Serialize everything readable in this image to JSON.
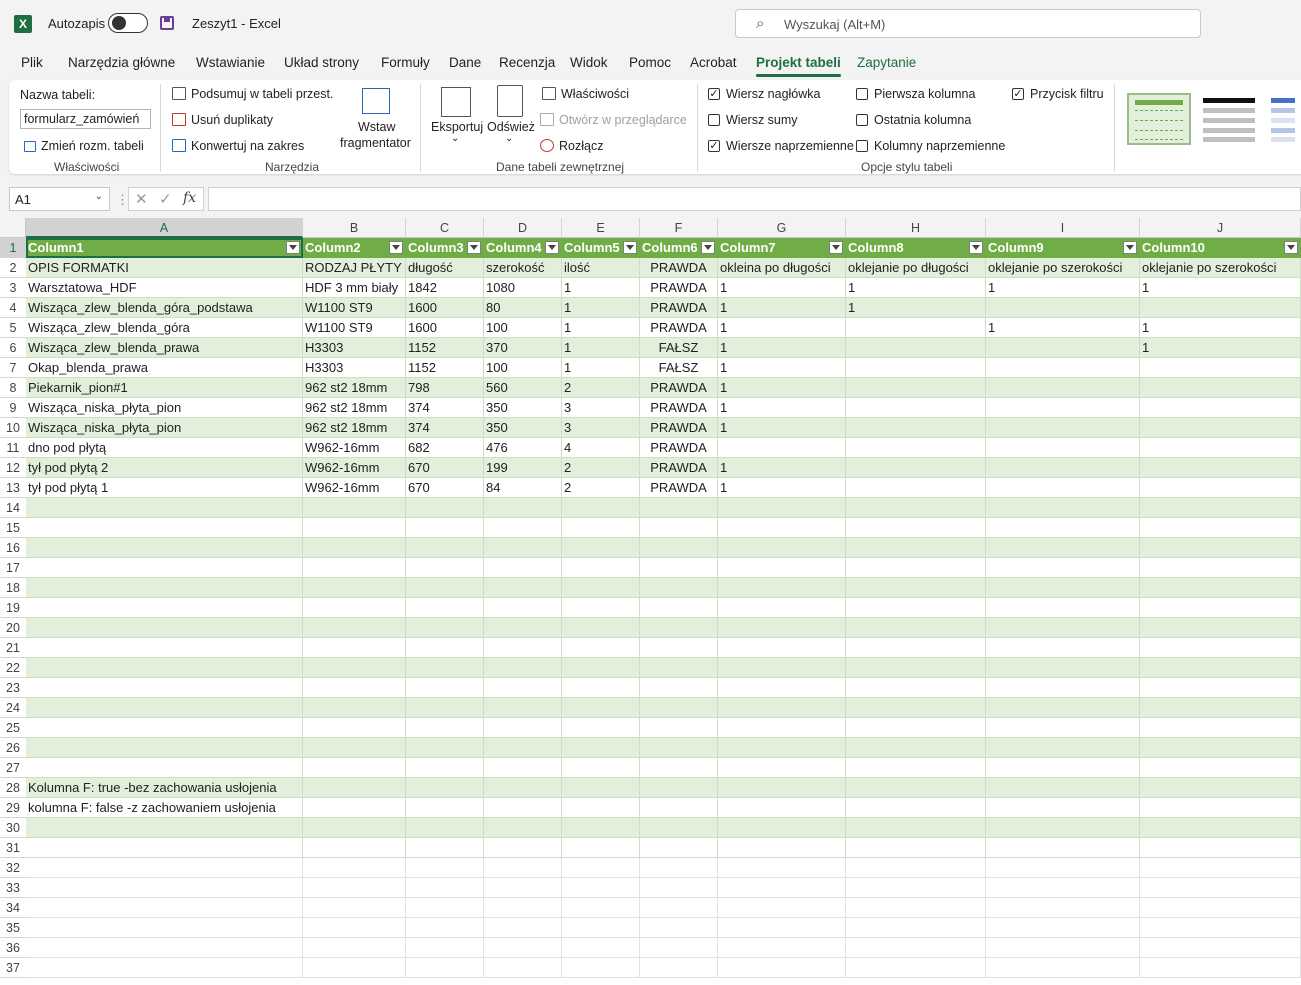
{
  "app": {
    "logo_letter": "X",
    "autosave_label": "Autozapis",
    "document_title": "Zeszyt1  -  Excel",
    "search_placeholder": "Wyszukaj (Alt+M)"
  },
  "tabs": [
    "Plik",
    "Narzędzia główne",
    "Wstawianie",
    "Układ strony",
    "Formuły",
    "Dane",
    "Recenzja",
    "Widok",
    "Pomoc",
    "Acrobat",
    "Projekt tabeli",
    "Zapytanie"
  ],
  "active_tab": "Projekt tabeli",
  "ribbon": {
    "table_name_label": "Nazwa tabeli:",
    "table_name_value": "formularz_zamówień",
    "resize_table": "Zmień rozm. tabeli",
    "group_properties": "Właściwości",
    "summarize_pivot": "Podsumuj w tabeli przest.",
    "remove_duplicates": "Usuń duplikaty",
    "convert_to_range": "Konwertuj na zakres",
    "insert_slicer_line1": "Wstaw",
    "insert_slicer_line2": "fragmentator",
    "group_tools": "Narzędzia",
    "export": "Eksportuj",
    "refresh": "Odśwież",
    "properties": "Właściwości",
    "open_in_browser": "Otwórz w przeglądarce",
    "unlink": "Rozłącz",
    "group_external": "Dane tabeli zewnętrznej",
    "options": [
      {
        "label": "Wiersz nagłówka",
        "checked": true
      },
      {
        "label": "Wiersz sumy",
        "checked": false
      },
      {
        "label": "Wiersze naprzemienne",
        "checked": true
      },
      {
        "label": "Pierwsza kolumna",
        "checked": false
      },
      {
        "label": "Ostatnia kolumna",
        "checked": false
      },
      {
        "label": "Kolumny naprzemienne",
        "checked": false
      },
      {
        "label": "Przycisk filtru",
        "checked": true
      }
    ],
    "group_style_options": "Opcje stylu tabeli"
  },
  "formula_bar": {
    "name_box": "A1",
    "fx": "fx",
    "formula": ""
  },
  "sheet": {
    "columns": [
      "A",
      "B",
      "C",
      "D",
      "E",
      "F",
      "G",
      "H",
      "I",
      "J"
    ],
    "selected_cell": "A1",
    "row_numbers": [
      "1",
      "2",
      "3",
      "4",
      "5",
      "6",
      "7",
      "8",
      "9",
      "10",
      "11",
      "12",
      "13",
      "14",
      "15",
      "16",
      "17",
      "18",
      "19",
      "20",
      "21",
      "22",
      "23",
      "24",
      "25",
      "26",
      "27",
      "28",
      "29",
      "30",
      "31",
      "32",
      "33",
      "34",
      "35",
      "36",
      "37"
    ],
    "header_row": [
      "Column1",
      "Column2",
      "Column3",
      "Column4",
      "Column5",
      "Column6",
      "Column7",
      "Column8",
      "Column9",
      "Column10"
    ],
    "rows": [
      [
        "OPIS FORMATKI",
        "RODZAJ PŁYTY",
        "długość",
        "szerokość",
        "ilość",
        "PRAWDA",
        "okleina po długości",
        "oklejanie po długości",
        "oklejanie po szerokości",
        "oklejanie po szerokości"
      ],
      [
        "Warsztatowa_HDF",
        "HDF 3 mm biały",
        "1842",
        "1080",
        "1",
        "PRAWDA",
        "1",
        "1",
        "1",
        "1"
      ],
      [
        "Wisząca_zlew_blenda_góra_podstawa",
        "W1100 ST9",
        "1600",
        "80",
        "1",
        "PRAWDA",
        "1",
        "1",
        "",
        ""
      ],
      [
        "Wisząca_zlew_blenda_góra",
        "W1100 ST9",
        "1600",
        "100",
        "1",
        "PRAWDA",
        "1",
        "",
        "1",
        "1"
      ],
      [
        "Wisząca_zlew_blenda_prawa",
        "H3303",
        "1152",
        "370",
        "1",
        "FAŁSZ",
        "1",
        "",
        "",
        "1"
      ],
      [
        "Okap_blenda_prawa",
        "H3303",
        "1152",
        "100",
        "1",
        "FAŁSZ",
        "1",
        "",
        "",
        ""
      ],
      [
        "Piekarnik_pion#1",
        "962 st2 18mm",
        "798",
        "560",
        "2",
        "PRAWDA",
        "1",
        "",
        "",
        ""
      ],
      [
        "Wisząca_niska_płyta_pion",
        "962 st2 18mm",
        "374",
        "350",
        "3",
        "PRAWDA",
        "1",
        "",
        "",
        ""
      ],
      [
        "Wisząca_niska_płyta_pion",
        "962 st2 18mm",
        "374",
        "350",
        "3",
        "PRAWDA",
        "1",
        "",
        "",
        ""
      ],
      [
        "dno pod płytą",
        "W962-16mm",
        "682",
        "476",
        "4",
        "PRAWDA",
        "",
        "",
        "",
        ""
      ],
      [
        "tył pod płytą 2",
        "W962-16mm",
        "670",
        "199",
        "2",
        "PRAWDA",
        "1",
        "",
        "",
        ""
      ],
      [
        "tył pod płytą 1",
        "W962-16mm",
        "670",
        "84",
        "2",
        "PRAWDA",
        "1",
        "",
        "",
        ""
      ],
      [
        "",
        "",
        "",
        "",
        "",
        "",
        "",
        "",
        "",
        ""
      ],
      [
        "",
        "",
        "",
        "",
        "",
        "",
        "",
        "",
        "",
        ""
      ],
      [
        "",
        "",
        "",
        "",
        "",
        "",
        "",
        "",
        "",
        ""
      ],
      [
        "",
        "",
        "",
        "",
        "",
        "",
        "",
        "",
        "",
        ""
      ],
      [
        "",
        "",
        "",
        "",
        "",
        "",
        "",
        "",
        "",
        ""
      ],
      [
        "",
        "",
        "",
        "",
        "",
        "",
        "",
        "",
        "",
        ""
      ],
      [
        "",
        "",
        "",
        "",
        "",
        "",
        "",
        "",
        "",
        ""
      ],
      [
        "",
        "",
        "",
        "",
        "",
        "",
        "",
        "",
        "",
        ""
      ],
      [
        "",
        "",
        "",
        "",
        "",
        "",
        "",
        "",
        "",
        ""
      ],
      [
        "",
        "",
        "",
        "",
        "",
        "",
        "",
        "",
        "",
        ""
      ],
      [
        "",
        "",
        "",
        "",
        "",
        "",
        "",
        "",
        "",
        ""
      ],
      [
        "",
        "",
        "",
        "",
        "",
        "",
        "",
        "",
        "",
        ""
      ],
      [
        "",
        "",
        "",
        "",
        "",
        "",
        "",
        "",
        "",
        ""
      ],
      [
        "",
        "",
        "",
        "",
        "",
        "",
        "",
        "",
        "",
        ""
      ],
      [
        "Kolumna F: true -bez zachowania usłojenia",
        "",
        "",
        "",
        "",
        "",
        "",
        "",
        "",
        ""
      ],
      [
        "kolumna F: false -z zachowaniem usłojenia",
        "",
        "",
        "",
        "",
        "",
        "",
        "",
        "",
        ""
      ],
      [
        "",
        "",
        "",
        "",
        "",
        "",
        "",
        "",
        "",
        ""
      ],
      [
        "",
        "",
        "",
        "",
        "",
        "",
        "",
        "",
        "",
        ""
      ]
    ],
    "centered_column": "F",
    "colors": {
      "header_fill": "#70ad47",
      "band_fill": "#e2efda",
      "accent": "#1d6f42"
    }
  }
}
